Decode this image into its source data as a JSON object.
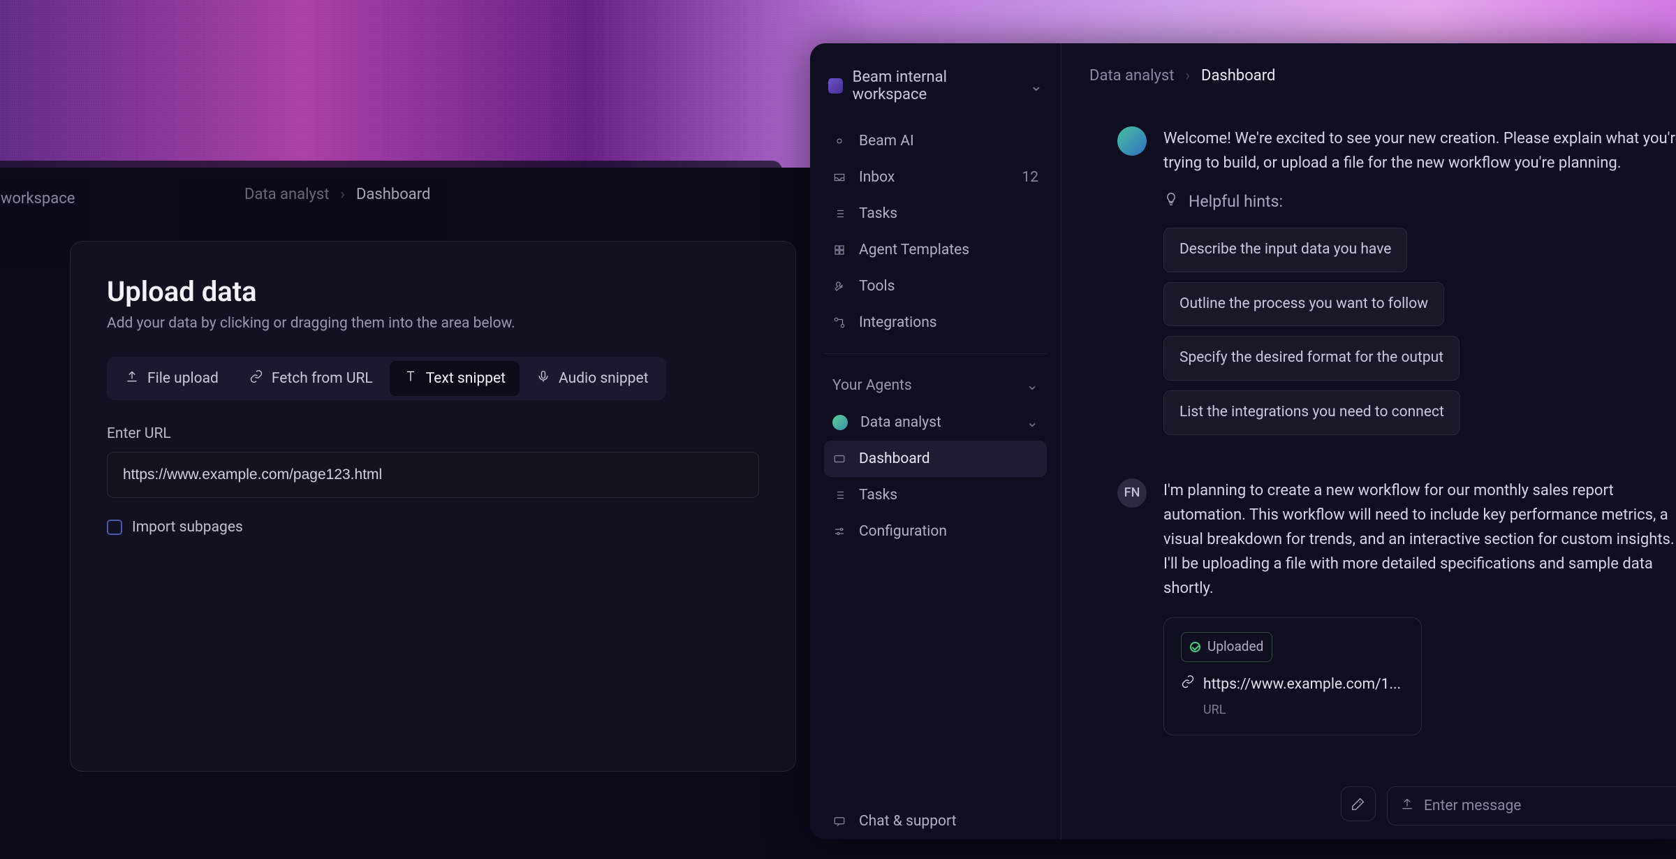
{
  "workspace": {
    "name": "Beam internal workspace"
  },
  "sidebar": {
    "items": [
      {
        "label": "Beam AI",
        "icon": "sparkle"
      },
      {
        "label": "Inbox",
        "icon": "inbox",
        "badge": "12"
      },
      {
        "label": "Tasks",
        "icon": "list"
      },
      {
        "label": "Agent Templates",
        "icon": "grid"
      },
      {
        "label": "Tools",
        "icon": "wrench"
      },
      {
        "label": "Integrations",
        "icon": "link"
      }
    ],
    "agents_section": "Your Agents",
    "agent": {
      "name": "Data analyst",
      "children": [
        {
          "label": "Dashboard",
          "active": true
        },
        {
          "label": "Tasks"
        },
        {
          "label": "Configuration"
        }
      ]
    },
    "footer": "Chat & support"
  },
  "breadcrumb": {
    "parent": "Data analyst",
    "current": "Dashboard"
  },
  "upload_modal": {
    "title": "Upload data",
    "subtitle": "Add your data by clicking or dragging them into the area below.",
    "tabs": [
      {
        "label": "File upload",
        "icon": "upload"
      },
      {
        "label": "Fetch from URL",
        "icon": "link"
      },
      {
        "label": "Text snippet",
        "icon": "text",
        "active": true
      },
      {
        "label": "Audio snippet",
        "icon": "mic"
      }
    ],
    "field_label": "Enter URL",
    "url_value": "https://www.example.com/page123.html",
    "checkbox_label": "Import subpages"
  },
  "chat": {
    "bot_text": "Welcome! We're excited to see your new creation. Please explain what you're trying to build, or upload a file for the new workflow you're planning.",
    "hints_label": "Helpful hints:",
    "hints": [
      "Describe the input data you have",
      "Outline the process you want to follow",
      "Specify the desired format for the output",
      "List the integrations you need to connect"
    ],
    "user_initials": "FN",
    "user_text": "I'm planning to create a new workflow for our monthly sales report automation. This workflow will need to include key performance metrics, a visual breakdown for trends, and an interactive section for custom insights. I'll be uploading a file with more detailed specifications and sample data shortly.",
    "attachment": {
      "status": "Uploaded",
      "name": "https://www.example.com/1...",
      "type": "URL"
    },
    "composer_placeholder": "Enter message"
  }
}
